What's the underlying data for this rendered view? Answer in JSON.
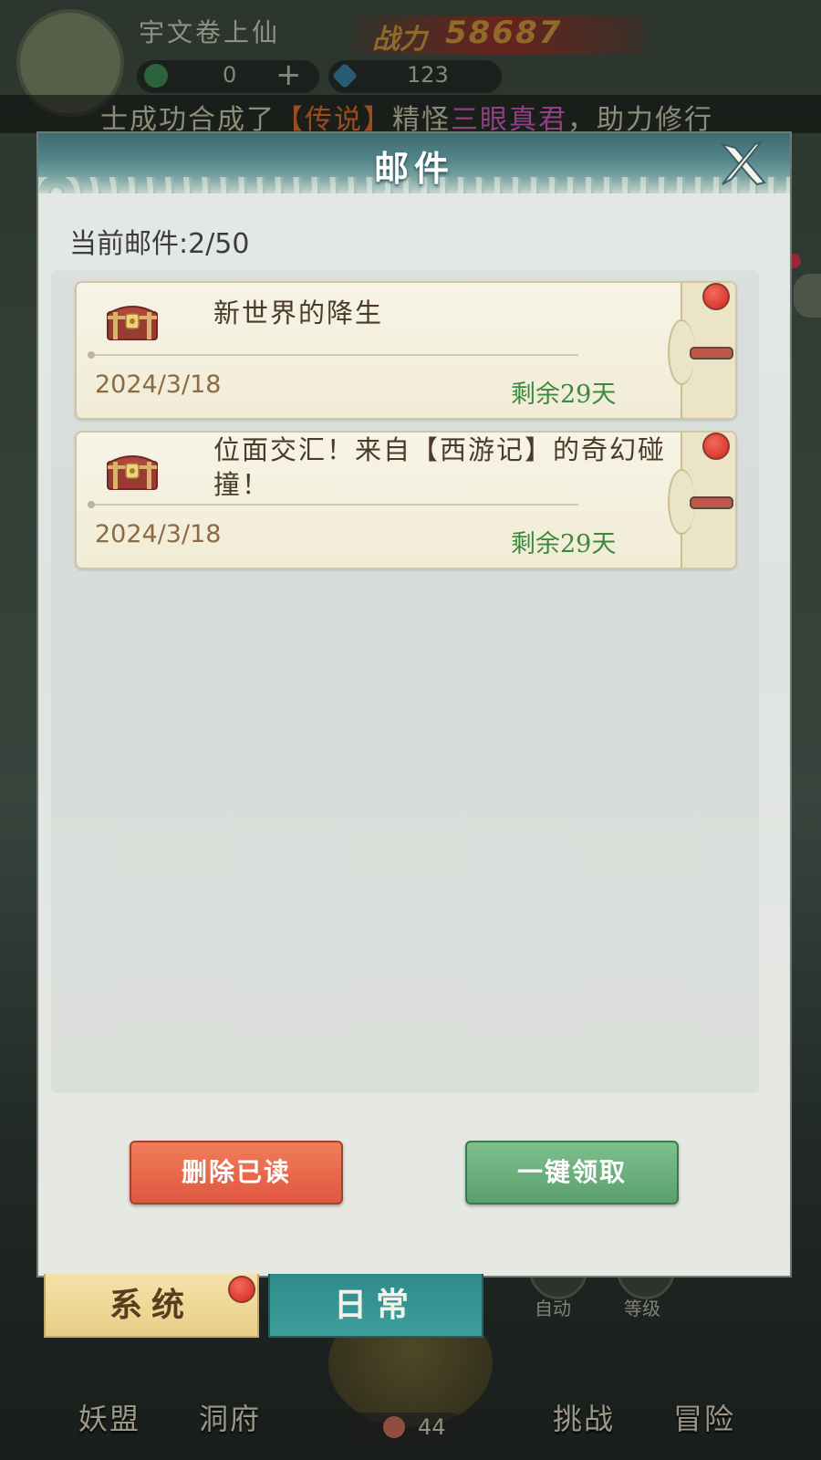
{
  "hud": {
    "player_name": "宇文卷上仙",
    "power_label": "战力",
    "power_value": "58687",
    "resource1_value": "0",
    "resource_plus": "+",
    "resource2_value": "123",
    "ticker_pre": "士成功合成了",
    "ticker_rarity": "【传说】",
    "ticker_mid": "精怪",
    "ticker_name": "三眼真君",
    "ticker_post": "，助力修行"
  },
  "modal": {
    "title": "邮件",
    "mail_count_label": "当前邮件:",
    "mail_count_value": "2/50",
    "mails": [
      {
        "subject": "新世界的降生",
        "date": "2024/3/18",
        "remaining": "剩余29天",
        "unread": true
      },
      {
        "subject": "位面交汇！来自【西游记】的奇幻碰撞！",
        "date": "2024/3/18",
        "remaining": "剩余29天",
        "unread": true
      }
    ],
    "delete_read_label": "删除已读",
    "claim_all_label": "一键领取"
  },
  "tabs": {
    "system_label": "系统",
    "daily_label": "日常"
  },
  "bottom_nav": {
    "auto_label": "自动",
    "level_label": "等级",
    "guild_label": "妖盟",
    "cave_label": "洞府",
    "orb_value": "44",
    "challenge_label": "挑战",
    "adventure_label": "冒险"
  },
  "colors": {
    "header_teal": "#54868a",
    "unread_dot": "#d3271d",
    "remaining_green": "#3b8a3c",
    "date_brown": "#8b6a44",
    "delete_red": "#e0573f",
    "claim_green": "#5aa06c"
  },
  "icons": {
    "close": "close-x-icon",
    "mail_item": "treasure-chest-icon"
  }
}
